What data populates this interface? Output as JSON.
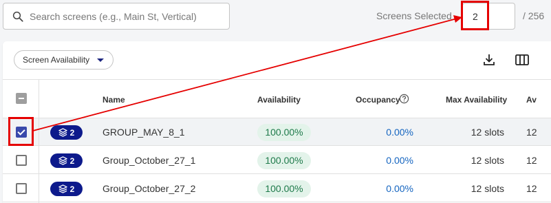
{
  "search": {
    "placeholder": "Search screens (e.g., Main St, Vertical)",
    "value": ""
  },
  "selection": {
    "label": "Screens Selected",
    "count": "2",
    "total": "/ 256"
  },
  "toolbar": {
    "filter_label": "Screen Availability"
  },
  "table": {
    "headers": {
      "name": "Name",
      "availability": "Availability",
      "occupancy": "Occupancy",
      "max_availability": "Max Availability",
      "next": "Av"
    },
    "rows": [
      {
        "badge": "2",
        "name": "GROUP_MAY_8_1",
        "availability": "100.00%",
        "occupancy": "0.00%",
        "max_availability": "12 slots",
        "next": "12",
        "selected": true
      },
      {
        "badge": "2",
        "name": "Group_October_27_1",
        "availability": "100.00%",
        "occupancy": "0.00%",
        "max_availability": "12 slots",
        "next": "12",
        "selected": false
      },
      {
        "badge": "2",
        "name": "Group_October_27_2",
        "availability": "100.00%",
        "occupancy": "0.00%",
        "max_availability": "12 slots",
        "next": "12",
        "selected": false
      }
    ]
  },
  "colors": {
    "accent": "#1a237e",
    "badge": "#0d1a8c",
    "checkbox": "#3949ab",
    "link": "#1565c0",
    "pill_bg": "#e3f3ea",
    "pill_text": "#1e7a4a",
    "annotation": "#e50000"
  },
  "icons": {
    "search": "search-icon",
    "download": "download-icon",
    "columns": "columns-icon",
    "group": "layers-icon",
    "help": "help-circle-icon"
  }
}
